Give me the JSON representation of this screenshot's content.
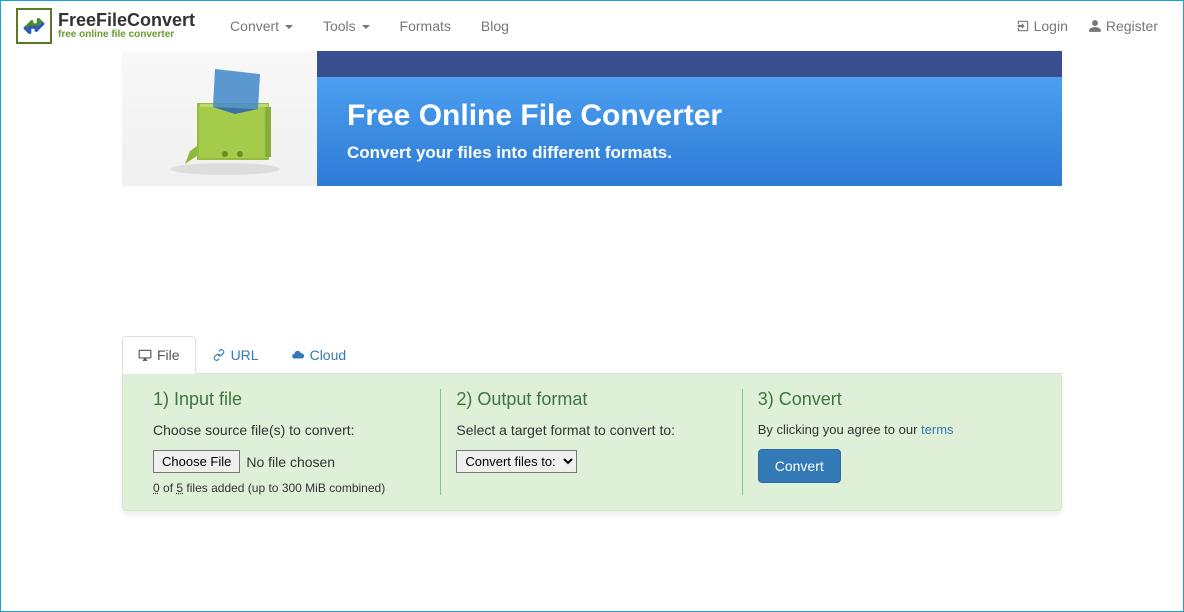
{
  "brand": {
    "main": "FreeFileConvert",
    "sub": "free online file converter"
  },
  "nav": {
    "convert": "Convert",
    "tools": "Tools",
    "formats": "Formats",
    "blog": "Blog"
  },
  "auth": {
    "login": "Login",
    "register": "Register"
  },
  "hero": {
    "title": "Free Online File Converter",
    "subtitle": "Convert your files into different formats."
  },
  "tabs": {
    "file": "File",
    "url": "URL",
    "cloud": "Cloud"
  },
  "step1": {
    "title": "1) Input file",
    "desc": "Choose source file(s) to convert:",
    "choose": "Choose File",
    "nofile": "No file chosen",
    "count_added": "0",
    "of": "of",
    "count_max": "5",
    "help_suffix": "files added (up to 300 MiB combined)"
  },
  "step2": {
    "title": "2) Output format",
    "desc": "Select a target format to convert to:",
    "select": "Convert files to:"
  },
  "step3": {
    "title": "3) Convert",
    "desc": "By clicking you agree to our ",
    "terms": "terms",
    "button": "Convert"
  }
}
